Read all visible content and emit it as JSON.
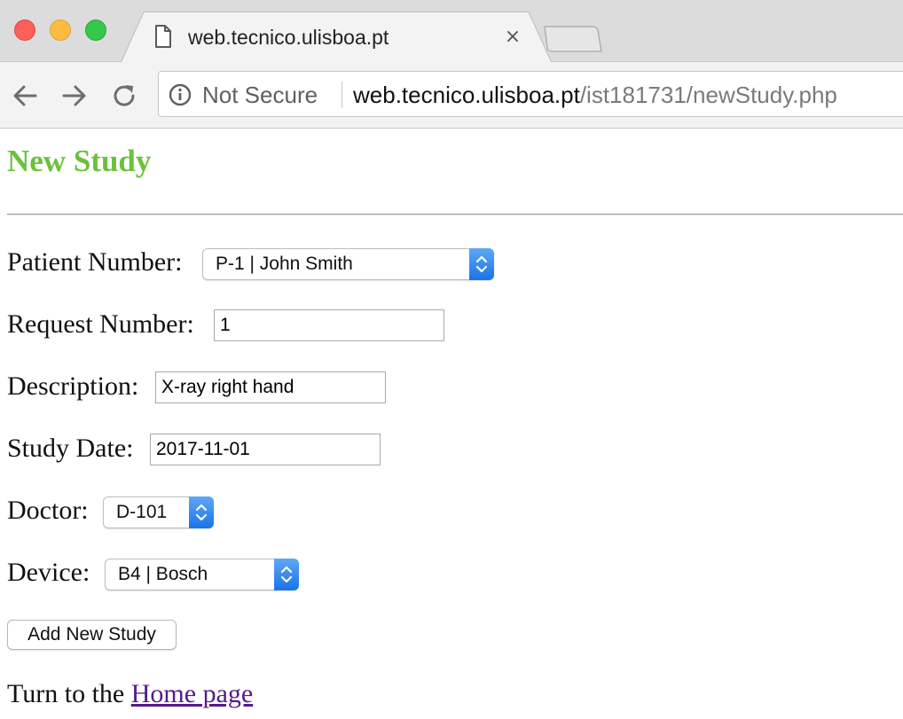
{
  "browser": {
    "tab_title": "web.tecnico.ulisboa.pt",
    "close_glyph": "×",
    "security_label": "Not Secure",
    "url_host": "web.tecnico.ulisboa.pt",
    "url_path": "/ist181731/newStudy.php"
  },
  "page": {
    "title": "New Study",
    "title_color": "#6bc23a",
    "fields": {
      "patient": {
        "label": "Patient Number:",
        "value": "P-1 | John Smith"
      },
      "request": {
        "label": "Request Number:",
        "value": "1"
      },
      "description": {
        "label": "Description:",
        "value": "X-ray right hand"
      },
      "study_date": {
        "label": "Study Date:",
        "value": "2017-11-01"
      },
      "doctor": {
        "label": "Doctor:",
        "value": "D-101"
      },
      "device": {
        "label": "Device:",
        "value": "B4 | Bosch"
      }
    },
    "submit_label": "Add New Study",
    "footer_prefix": "Turn to the ",
    "footer_link": "Home page",
    "link_color": "#551a8b"
  },
  "icons": {
    "tab": "document-icon",
    "back": "back-arrow-icon",
    "forward": "forward-arrow-icon",
    "reload": "reload-icon",
    "security": "info-icon",
    "select_arrows": "updown-chevron-icon"
  }
}
